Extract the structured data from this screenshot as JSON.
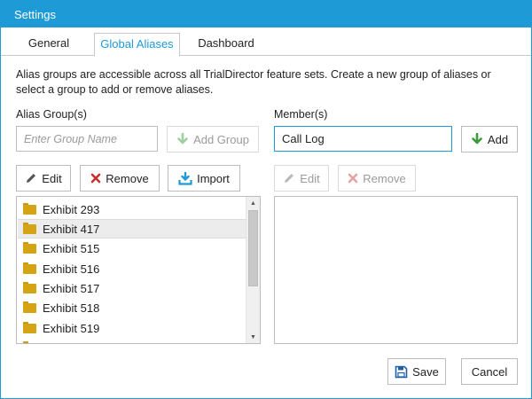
{
  "window": {
    "title": "Settings"
  },
  "tabs": [
    {
      "label": "General",
      "active": false
    },
    {
      "label": "Global Aliases",
      "active": true
    },
    {
      "label": "Dashboard",
      "active": false
    }
  ],
  "description": "Alias groups are accessible across all TrialDirector feature sets. Create a new group of aliases or select a group to add or remove aliases.",
  "alias_groups": {
    "label": "Alias Group(s)",
    "input_value": "",
    "input_placeholder": "Enter Group Name",
    "add_label": "Add Group",
    "edit_label": "Edit",
    "remove_label": "Remove",
    "import_label": "Import",
    "items": [
      {
        "label": "Exhibit 293"
      },
      {
        "label": "Exhibit 417",
        "selected": true
      },
      {
        "label": "Exhibit 515"
      },
      {
        "label": "Exhibit 516"
      },
      {
        "label": "Exhibit 517"
      },
      {
        "label": "Exhibit 518"
      },
      {
        "label": "Exhibit 519"
      },
      {
        "label": ""
      }
    ]
  },
  "members": {
    "label": "Member(s)",
    "input_value": "Call Log",
    "add_label": "Add",
    "edit_label": "Edit",
    "remove_label": "Remove",
    "items": []
  },
  "footer": {
    "save_label": "Save",
    "cancel_label": "Cancel"
  },
  "colors": {
    "accent": "#1e9ad6",
    "folder": "#d4a415",
    "remove_red": "#c9302c",
    "add_green": "#3c9a3c"
  },
  "icons": {
    "edit": "pencil-icon",
    "remove": "x-icon",
    "import": "import-icon",
    "add": "arrow-down-icon",
    "save": "floppy-disk-icon",
    "folder": "folder-icon"
  }
}
